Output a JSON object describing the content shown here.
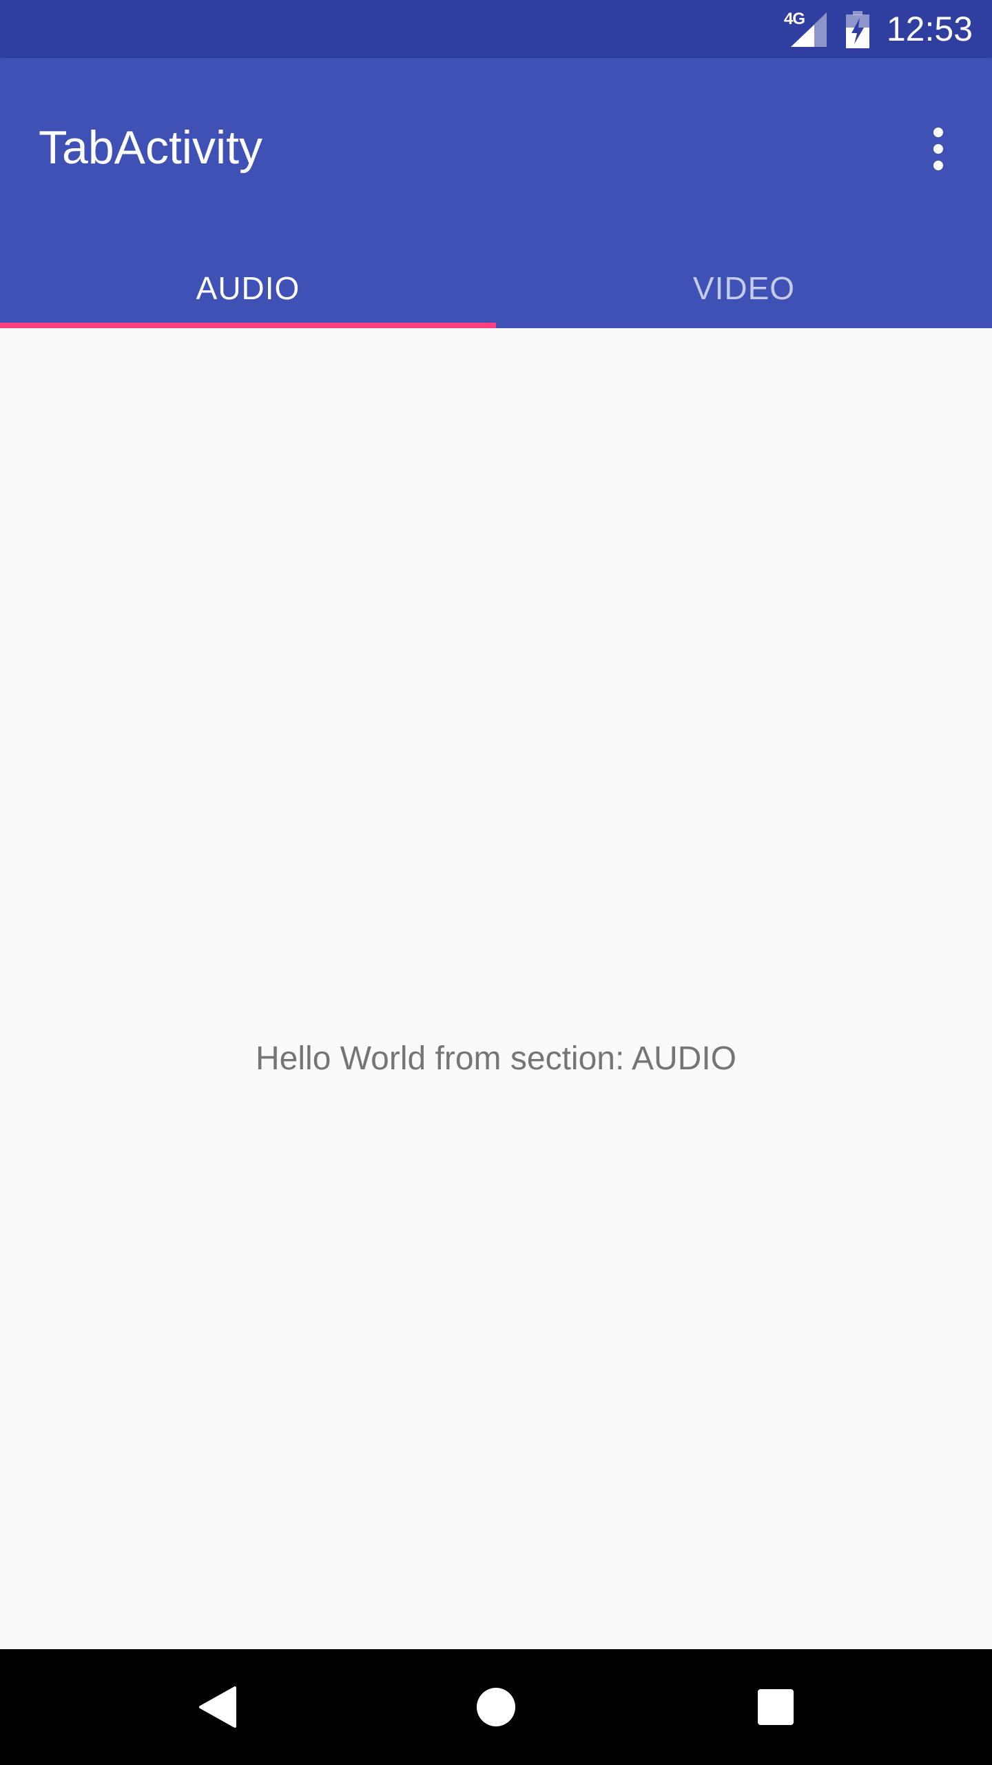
{
  "status_bar": {
    "network": "4G",
    "time": "12:53",
    "icons": [
      "signal-icon",
      "battery-charging-icon"
    ]
  },
  "app_bar": {
    "title": "TabActivity",
    "menu_icon": "overflow-menu-icon"
  },
  "tabs": [
    {
      "label": "AUDIO",
      "active": true
    },
    {
      "label": "VIDEO",
      "active": false
    }
  ],
  "content": {
    "text": "Hello World from section: AUDIO"
  },
  "nav_bar": {
    "icons": [
      "back-icon",
      "home-icon",
      "recents-icon"
    ]
  },
  "colors": {
    "status_bar": "#303f9f",
    "primary": "#3f51b5",
    "accent": "#ff4081",
    "background": "#fafafa",
    "body_text": "#757575"
  }
}
